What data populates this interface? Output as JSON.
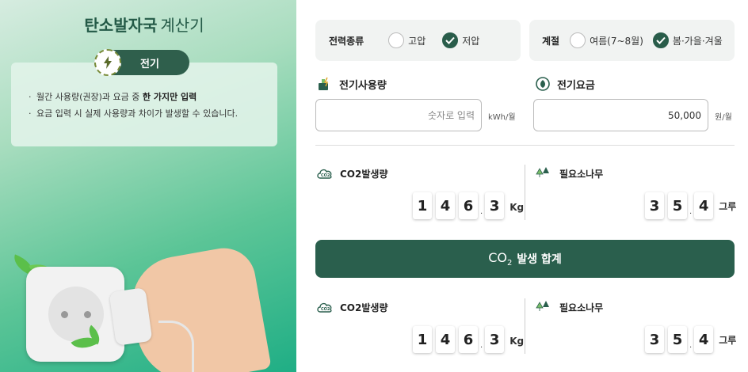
{
  "left": {
    "title_bold": "탄소발자국",
    "title_thin": "계산기",
    "badge": "전기",
    "info": {
      "line1_pre": "월간 사용량(권장)과 요금 중 ",
      "line1_bold": "한 가지만 입력",
      "line2": "요금 입력 시 실제 사용량과 차이가 발생할 수 있습니다."
    }
  },
  "power_type": {
    "label": "전력종류",
    "options": [
      {
        "label": "고압",
        "checked": false
      },
      {
        "label": "저압",
        "checked": true
      }
    ]
  },
  "season": {
    "label": "계절",
    "options": [
      {
        "label": "여름(7~8월)",
        "checked": false
      },
      {
        "label": "봄·가을·겨울",
        "checked": true
      }
    ]
  },
  "usage": {
    "label": "전기사용량",
    "placeholder": "숫자로 입력",
    "value": "",
    "unit": "kWh/월"
  },
  "fee": {
    "label": "전기요금",
    "value": "50,000",
    "unit": "원/월"
  },
  "result_top": {
    "co2_label": "CO2발생량",
    "co2_digits": [
      "1",
      "4",
      "6",
      "3"
    ],
    "co2_unit": "Kg",
    "tree_label": "필요소나무",
    "tree_digits": [
      "3",
      "5",
      "4"
    ],
    "tree_unit": "그루"
  },
  "sum_button": {
    "co2": "CO",
    "co2_sub": "2",
    "label": "발생 합계"
  },
  "result_bottom": {
    "co2_label": "CO2발생량",
    "co2_digits": [
      "1",
      "4",
      "6",
      "3"
    ],
    "co2_unit": "Kg",
    "tree_label": "필요소나무",
    "tree_digits": [
      "3",
      "5",
      "4"
    ],
    "tree_unit": "그루"
  },
  "colors": {
    "primary": "#2a5f4d",
    "check": "#295c4a"
  }
}
